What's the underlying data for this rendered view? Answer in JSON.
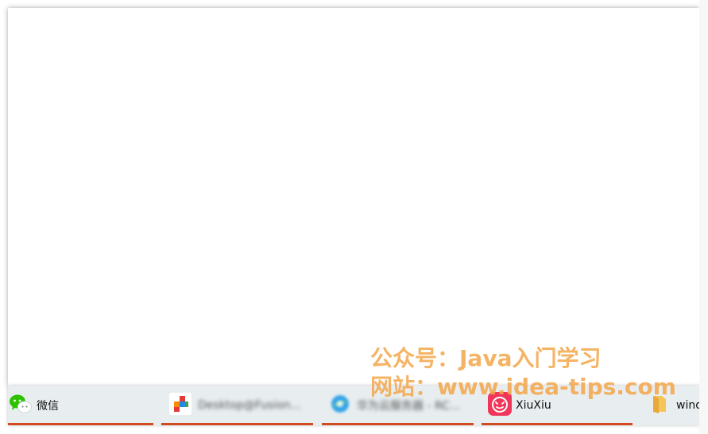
{
  "taskbar": {
    "items": [
      {
        "label": "微信",
        "icon": "wechat-icon",
        "blurred": false
      },
      {
        "label": "Desktop@Fusion...",
        "icon": "colorful-app-icon",
        "blurred": true
      },
      {
        "label": "华为云服务器 - RC...",
        "icon": "browser-icon",
        "blurred": true
      },
      {
        "label": "XiuXiu",
        "icon": "xiuxiu-icon",
        "blurred": false
      },
      {
        "label": "wind",
        "icon": "folder-icon",
        "blurred": false
      }
    ]
  },
  "watermark": {
    "line1": "公众号：Java入门学习",
    "line2": "网站：www.idea-tips.com"
  },
  "colors": {
    "underline": "#d2491c",
    "watermark": "#f4a64a",
    "taskbar_bg": "#e8eef0"
  }
}
